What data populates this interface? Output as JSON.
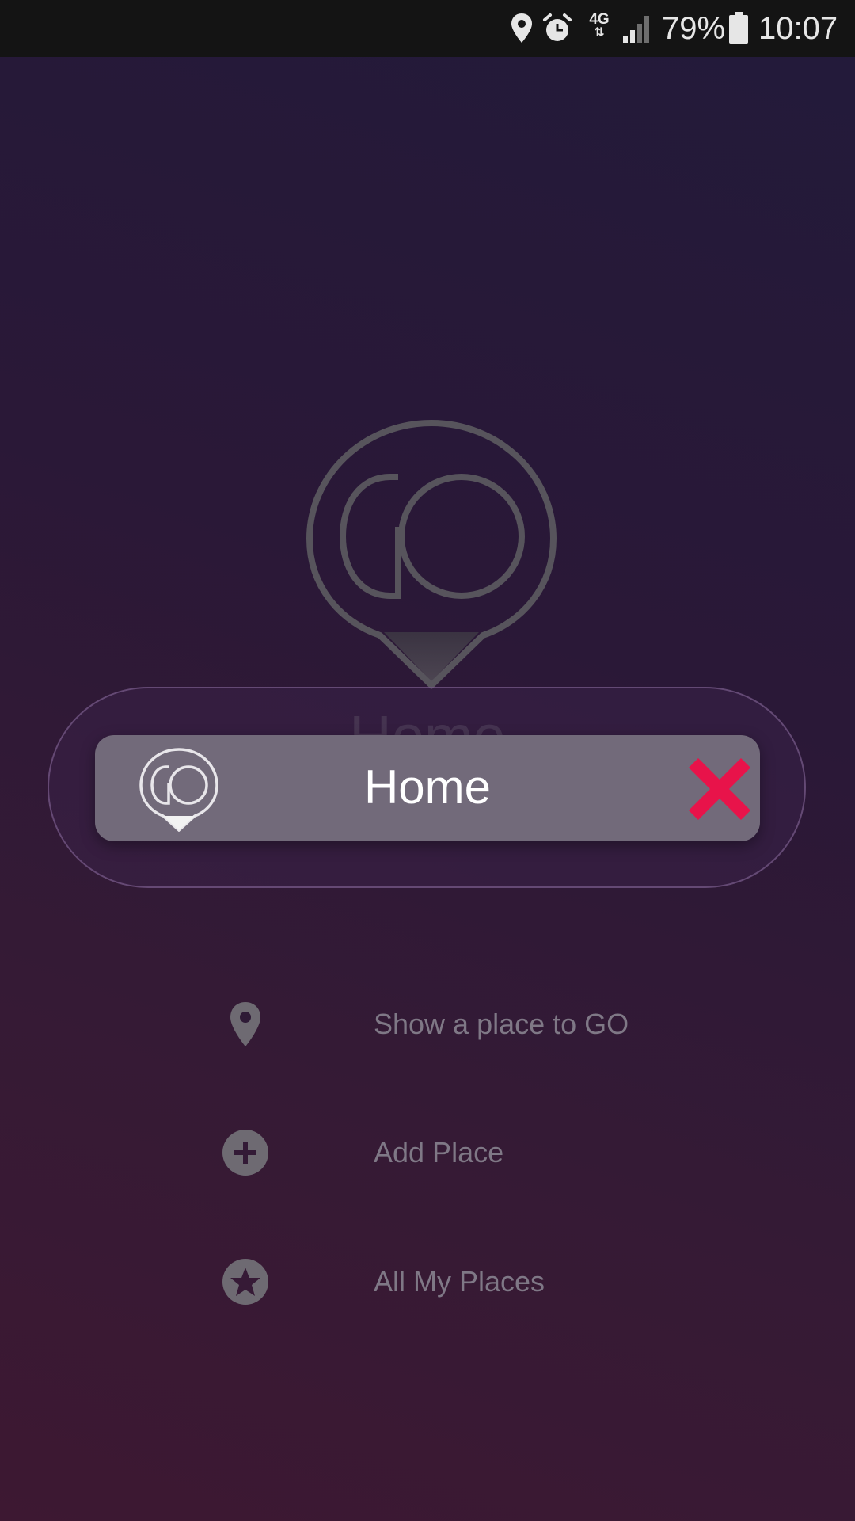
{
  "status_bar": {
    "network_type": "4G",
    "battery_percent": "79%",
    "time": "10:07",
    "icons": [
      "location-icon",
      "alarm-icon",
      "network-4g-icon",
      "signal-icon",
      "battery-icon"
    ]
  },
  "background": {
    "logo_text": "GO",
    "title": "Home"
  },
  "place_tag": {
    "label": "Home",
    "logo_text": "GO",
    "close_icon": "close-icon",
    "close_color": "#e8134a"
  },
  "menu": {
    "items": [
      {
        "label": "Show a place to GO",
        "icon": "location-pin-icon"
      },
      {
        "label": "Add Place",
        "icon": "add-circle-icon"
      },
      {
        "label": "All My Places",
        "icon": "star-circle-icon"
      }
    ]
  },
  "colors": {
    "accent": "#e8134a",
    "tag_background": "#726a7a",
    "menu_text": "#7f7886"
  }
}
